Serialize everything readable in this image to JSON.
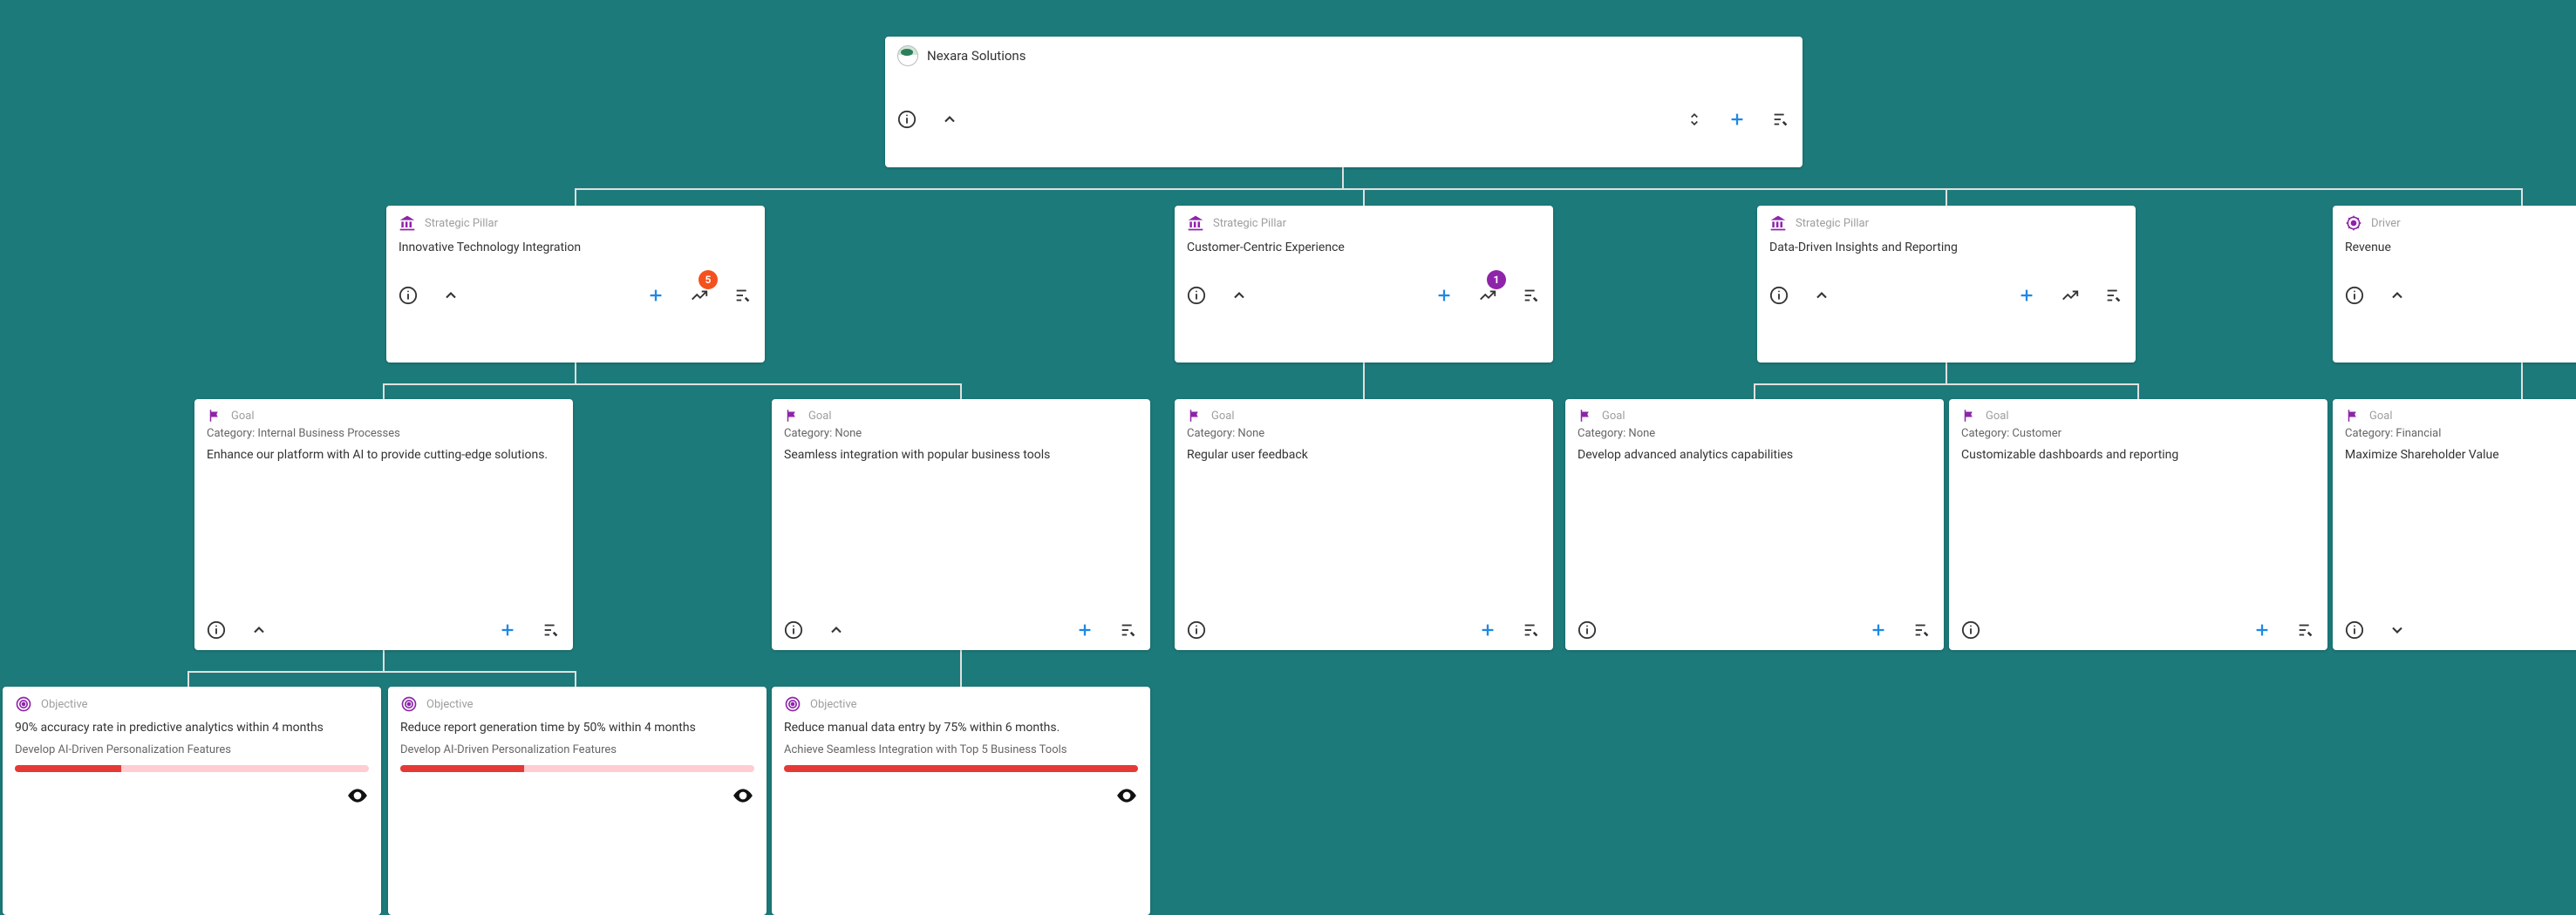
{
  "root": {
    "title": "Nexara Solutions"
  },
  "types": {
    "pillar": "Strategic Pillar",
    "driver": "Driver",
    "goal": "Goal",
    "objective": "Objective"
  },
  "pillars": [
    {
      "title": "Innovative Technology Integration",
      "badge": "5"
    },
    {
      "title": "Customer-Centric Experience",
      "badge": "1"
    },
    {
      "title": "Data-Driven Insights and Reporting"
    }
  ],
  "driver": {
    "title": "Revenue"
  },
  "goals": [
    {
      "category": "Category: Internal Business Processes",
      "desc": "Enhance our platform with AI to provide cutting-edge solutions."
    },
    {
      "category": "Category: None",
      "desc": "Seamless integration with popular business tools"
    },
    {
      "category": "Category: None",
      "desc": "Regular user feedback"
    },
    {
      "category": "Category: None",
      "desc": "Develop advanced analytics capabilities"
    },
    {
      "category": "Category: Customer",
      "desc": "Customizable dashboards and reporting"
    },
    {
      "category": "Category: Financial",
      "desc": "Maximize Shareholder Value"
    }
  ],
  "objectives": [
    {
      "title": "90% accuracy rate in predictive analytics within 4 months",
      "sub": "Develop AI-Driven Personalization Features",
      "progress": 30
    },
    {
      "title": "Reduce report generation time by 50% within 4 months",
      "sub": "Develop AI-Driven Personalization Features",
      "progress": 35
    },
    {
      "title": "Reduce manual data entry by 75% within 6 months.",
      "sub": "Achieve Seamless Integration with Top 5 Business Tools",
      "progress": 100
    }
  ]
}
